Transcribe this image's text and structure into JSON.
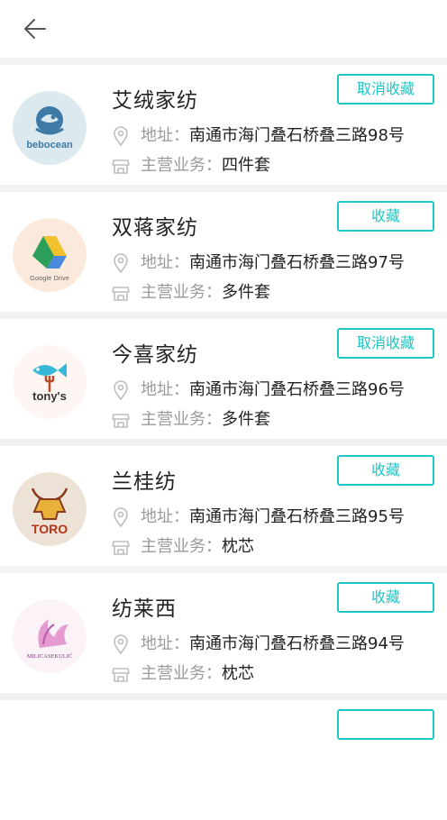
{
  "header": {
    "back_icon": "arrow-left-icon"
  },
  "colors": {
    "accent": "#20c5c5",
    "text": "#222222",
    "muted": "#9a9a9a",
    "background": "#f2f2f2"
  },
  "labels": {
    "address": "地址：",
    "business": "主营业务："
  },
  "shops": [
    {
      "name": "艾绒家纺",
      "address": "南通市海门叠石桥叠三路98号",
      "business": "四件套",
      "button": "取消收藏",
      "logo": "bebocean-logo",
      "logo_text": "bebocean"
    },
    {
      "name": "双蒋家纺",
      "address": "南通市海门叠石桥叠三路97号",
      "business": "多件套",
      "button": "收藏",
      "logo": "google-drive-logo",
      "logo_text": "Google Drive"
    },
    {
      "name": "今喜家纺",
      "address": "南通市海门叠石桥叠三路96号",
      "business": "多件套",
      "button": "取消收藏",
      "logo": "tonys-logo",
      "logo_text": "tony's"
    },
    {
      "name": "兰桂纺",
      "address": "南通市海门叠石桥叠三路95号",
      "business": "枕芯",
      "button": "收藏",
      "logo": "toro-logo",
      "logo_text": "TORO"
    },
    {
      "name": "纺莱西",
      "address": "南通市海门叠石桥叠三路94号",
      "business": "枕芯",
      "button": "收藏",
      "logo": "milica-sekulic-logo",
      "logo_text": "MILICASEKULIĆ"
    }
  ]
}
